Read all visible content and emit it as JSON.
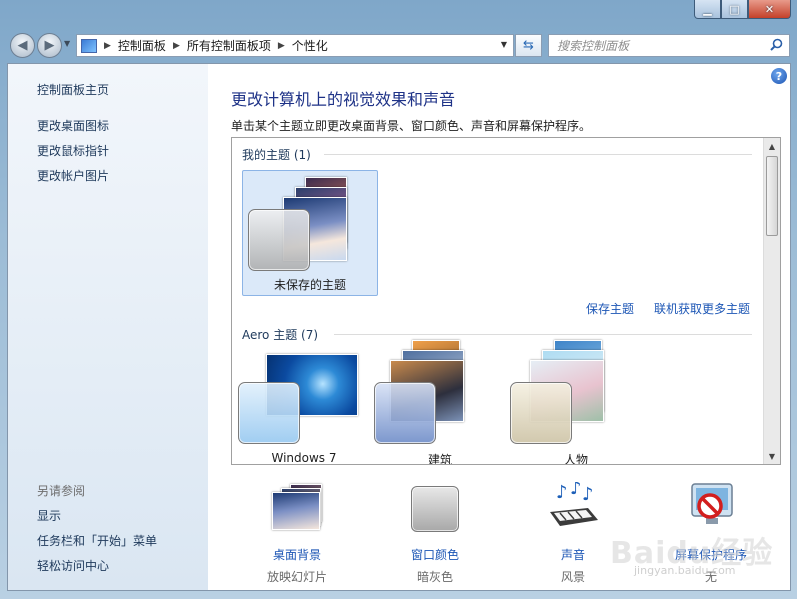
{
  "window": {
    "minimize_glyph": "▁",
    "maximize_glyph": "□",
    "close_glyph": "✕"
  },
  "address": {
    "crumbs": [
      "控制面板",
      "所有控制面板项",
      "个性化"
    ]
  },
  "search": {
    "placeholder": "搜索控制面板"
  },
  "sidebar": {
    "home": "控制面板主页",
    "links": [
      "更改桌面图标",
      "更改鼠标指针",
      "更改帐户图片"
    ],
    "see_also_title": "另请参阅",
    "see_also": [
      "显示",
      "任务栏和「开始」菜单",
      "轻松访问中心"
    ]
  },
  "main": {
    "title": "更改计算机上的视觉效果和声音",
    "subtitle": "单击某个主题立即更改桌面背景、窗口颜色、声音和屏幕保护程序。",
    "my_themes_title": "我的主题 (1)",
    "my_themes": [
      {
        "name": "未保存的主题"
      }
    ],
    "save_theme": "保存主题",
    "get_more": "联机获取更多主题",
    "aero_title": "Aero 主题 (7)",
    "aero_themes": [
      {
        "name": "Windows 7"
      },
      {
        "name": "建筑"
      },
      {
        "name": "人物"
      }
    ]
  },
  "bottom": [
    {
      "label": "桌面背景",
      "sub": "放映幻灯片"
    },
    {
      "label": "窗口颜色",
      "sub": "暗灰色"
    },
    {
      "label": "声音",
      "sub": "风景"
    },
    {
      "label": "屏幕保护程序",
      "sub": "无"
    }
  ],
  "watermark": {
    "main": "Baidu经验",
    "sub": "jingyan.baidu.com"
  },
  "colors": {
    "link": "#1c56b5",
    "heading": "#1e3287",
    "selected": "#dbe9f9"
  }
}
